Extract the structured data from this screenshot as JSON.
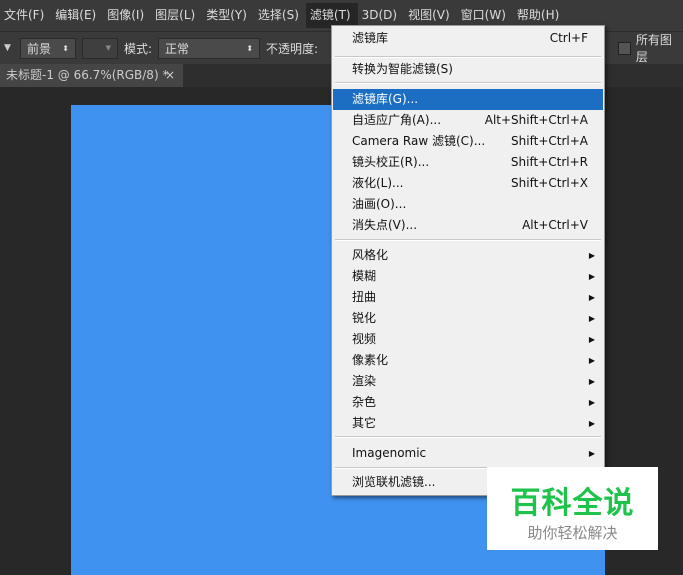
{
  "menubar": [
    "文件(F)",
    "编辑(E)",
    "图像(I)",
    "图层(L)",
    "类型(Y)",
    "选择(S)",
    "滤镜(T)",
    "3D(D)",
    "视图(V)",
    "窗口(W)",
    "帮助(H)"
  ],
  "options": {
    "source": "前景",
    "mode_label": "模式:",
    "mode": "正常",
    "opacity_label": "不透明度:",
    "all_layers": "所有图层"
  },
  "tab": {
    "title": "未标题-1 @ 66.7%(RGB/8) *",
    "close": "×"
  },
  "menu": {
    "last_filter": {
      "label": "滤镜库",
      "shortcut": "Ctrl+F"
    },
    "smart": "转换为智能滤镜(S)",
    "group1": [
      {
        "label": "滤镜库(G)...",
        "shortcut": ""
      },
      {
        "label": "自适应广角(A)...",
        "shortcut": "Alt+Shift+Ctrl+A"
      },
      {
        "label": "Camera Raw 滤镜(C)...",
        "shortcut": "Shift+Ctrl+A"
      },
      {
        "label": "镜头校正(R)...",
        "shortcut": "Shift+Ctrl+R"
      },
      {
        "label": "液化(L)...",
        "shortcut": "Shift+Ctrl+X"
      },
      {
        "label": "油画(O)...",
        "shortcut": ""
      },
      {
        "label": "消失点(V)...",
        "shortcut": "Alt+Ctrl+V"
      }
    ],
    "submenus": [
      "风格化",
      "模糊",
      "扭曲",
      "锐化",
      "视频",
      "像素化",
      "渲染",
      "杂色",
      "其它"
    ],
    "imagenomic": "Imagenomic",
    "browse": "浏览联机滤镜..."
  },
  "watermark": {
    "title": "百科全说",
    "subtitle": "助你轻松解决"
  }
}
